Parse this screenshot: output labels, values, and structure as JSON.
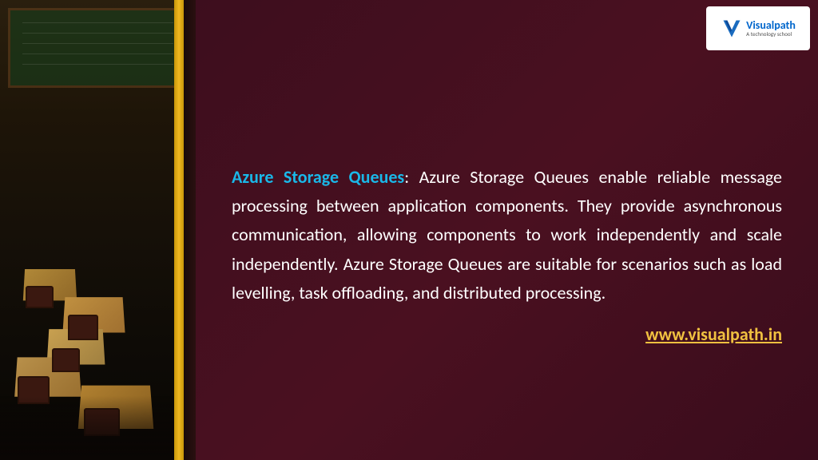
{
  "logo": {
    "v_letter": "V",
    "brand_name": "Visualpath",
    "tagline": "A technology school"
  },
  "content": {
    "title": "Azure Storage Queues",
    "colon": ":",
    "body_text": " Azure Storage Queues enable reliable message processing between application components. They provide asynchronous communication, allowing components to work independently and scale independently. Azure Storage Queues are suitable for scenarios such as load levelling, task offloading, and distributed processing.",
    "website": "www.visualpath.in"
  }
}
